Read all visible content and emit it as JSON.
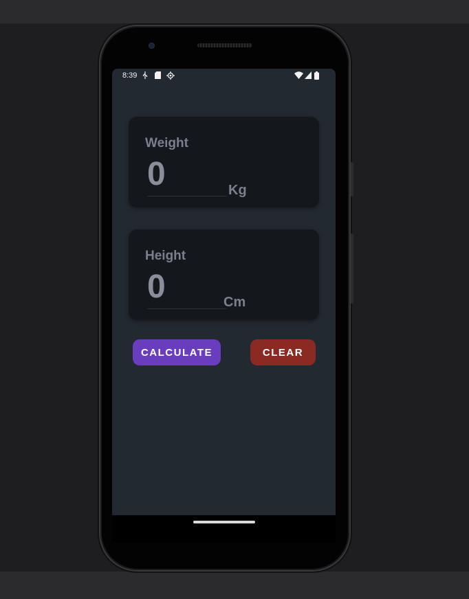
{
  "status_bar": {
    "time": "8:39",
    "left_icons": [
      "usb-icon",
      "sd-card-icon",
      "gps-icon"
    ],
    "right_icons": [
      "wifi-icon",
      "signal-icon",
      "battery-icon"
    ]
  },
  "weight": {
    "label": "Weight",
    "value": "0",
    "unit": "Kg"
  },
  "height": {
    "label": "Height",
    "value": "0",
    "unit": "Cm"
  },
  "buttons": {
    "calculate": "CALCULATE",
    "clear": "CLEAR"
  },
  "colors": {
    "screen_bg": "#222930",
    "card_bg": "#14181c",
    "calculate_bg": "#6a3dbf",
    "clear_bg": "#8b2a23",
    "label_text": "#7c7f8c"
  }
}
